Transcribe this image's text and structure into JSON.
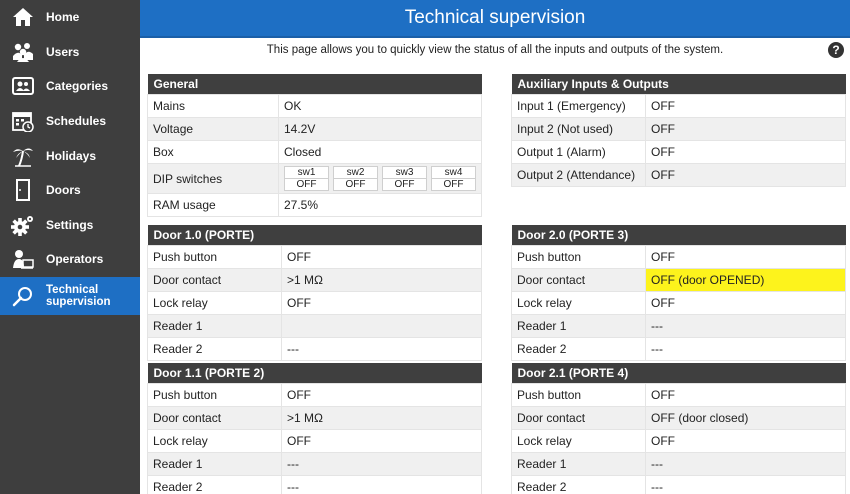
{
  "sidebar": {
    "items": [
      {
        "label": "Home",
        "icon": "home-icon"
      },
      {
        "label": "Users",
        "icon": "users-icon"
      },
      {
        "label": "Categories",
        "icon": "categories-icon"
      },
      {
        "label": "Schedules",
        "icon": "calendar-icon"
      },
      {
        "label": "Holidays",
        "icon": "palm-tree-icon"
      },
      {
        "label": "Doors",
        "icon": "door-icon"
      },
      {
        "label": "Settings",
        "icon": "gear-icon"
      },
      {
        "label": "Operators",
        "icon": "operator-icon"
      },
      {
        "label": "Technical supervision",
        "line1": "Technical",
        "line2": "supervision",
        "icon": "magnifier-icon",
        "active": true
      }
    ]
  },
  "header": {
    "title": "Technical supervision"
  },
  "intro": "This page allows you to quickly view the status of all the inputs and outputs of the system.",
  "general": {
    "title": "General",
    "rows": [
      {
        "label": "Mains",
        "value": "OK"
      },
      {
        "label": "Voltage",
        "value": "14.2V"
      },
      {
        "label": "Box",
        "value": "Closed"
      }
    ],
    "dip_label": "DIP switches",
    "dip": [
      {
        "name": "sw1",
        "state": "OFF"
      },
      {
        "name": "sw2",
        "state": "OFF"
      },
      {
        "name": "sw3",
        "state": "OFF"
      },
      {
        "name": "sw4",
        "state": "OFF"
      }
    ],
    "ram": {
      "label": "RAM usage",
      "value": "27.5%"
    }
  },
  "aux": {
    "title": "Auxiliary Inputs & Outputs",
    "rows": [
      {
        "label": "Input 1 (Emergency)",
        "value": "OFF"
      },
      {
        "label": "Input 2 (Not used)",
        "value": "OFF"
      },
      {
        "label": "Output 1 (Alarm)",
        "value": "OFF"
      },
      {
        "label": "Output 2 (Attendance)",
        "value": "OFF"
      }
    ]
  },
  "doors": {
    "d10": {
      "title": "Door 1.0 (PORTE)",
      "rows": [
        {
          "label": "Push button",
          "value": "OFF"
        },
        {
          "label": "Door contact",
          "value": ">1 MΩ"
        },
        {
          "label": "Lock relay",
          "value": "OFF"
        },
        {
          "label": "Reader 1",
          "value": ""
        },
        {
          "label": "Reader 2",
          "value": "---"
        }
      ]
    },
    "d20": {
      "title": "Door 2.0 (PORTE 3)",
      "rows": [
        {
          "label": "Push button",
          "value": "OFF"
        },
        {
          "label": "Door contact",
          "value": "OFF (door OPENED)"
        },
        {
          "label": "Lock relay",
          "value": "OFF"
        },
        {
          "label": "Reader 1",
          "value": "---"
        },
        {
          "label": "Reader 2",
          "value": "---"
        }
      ]
    },
    "d11": {
      "title": "Door 1.1 (PORTE 2)",
      "rows": [
        {
          "label": "Push button",
          "value": "OFF"
        },
        {
          "label": "Door contact",
          "value": ">1 MΩ"
        },
        {
          "label": "Lock relay",
          "value": "OFF"
        },
        {
          "label": "Reader 1",
          "value": "---"
        },
        {
          "label": "Reader 2",
          "value": "---"
        }
      ]
    },
    "d21": {
      "title": "Door 2.1 (PORTE 4)",
      "rows": [
        {
          "label": "Push button",
          "value": "OFF"
        },
        {
          "label": "Door contact",
          "value": "OFF (door closed)"
        },
        {
          "label": "Lock relay",
          "value": "OFF"
        },
        {
          "label": "Reader 1",
          "value": "---"
        },
        {
          "label": "Reader 2",
          "value": "---"
        }
      ]
    }
  },
  "colors": {
    "sidebar_bg": "#3e3e3e",
    "accent": "#1e6fc4",
    "table_header": "#3f3f3f",
    "highlight": "#fdf31c"
  }
}
